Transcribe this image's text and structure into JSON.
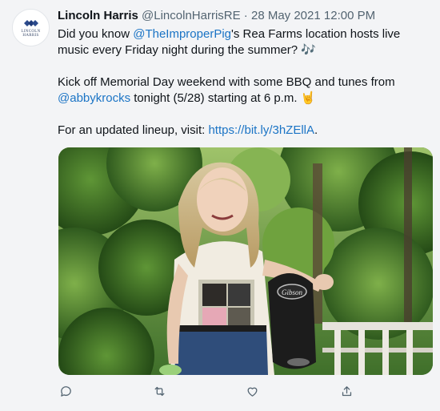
{
  "tweet": {
    "author_name": "Lincoln Harris",
    "author_handle": "@LincolnHarrisRE",
    "separator": " · ",
    "timestamp": "28 May 2021 12:00 PM",
    "avatar_text_line1": "LINCOLN",
    "avatar_text_line2": "HARRIS",
    "para1_prefix": "Did you know ",
    "para1_mention": "@TheImproperPig",
    "para1_suffix": "'s Rea Farms location hosts live music every Friday night during the summer? 🎶",
    "para2_prefix": "Kick off Memorial Day weekend with some BBQ and tunes from ",
    "para2_mention": "@abbykrocks",
    "para2_suffix": " tonight (5/28) starting at 6 p.m. 🤘",
    "para3_prefix": "For an updated lineup, visit: ",
    "para3_link": "https://bit.ly/3hZEllA",
    "para3_suffix": "."
  },
  "actions": {
    "reply_icon": "reply-icon",
    "retweet_icon": "retweet-icon",
    "like_icon": "heart-icon",
    "share_icon": "share-icon"
  },
  "colors": {
    "link": "#1b74c5",
    "secondary_text": "#536471",
    "brand_blue": "#2b4a8b"
  }
}
